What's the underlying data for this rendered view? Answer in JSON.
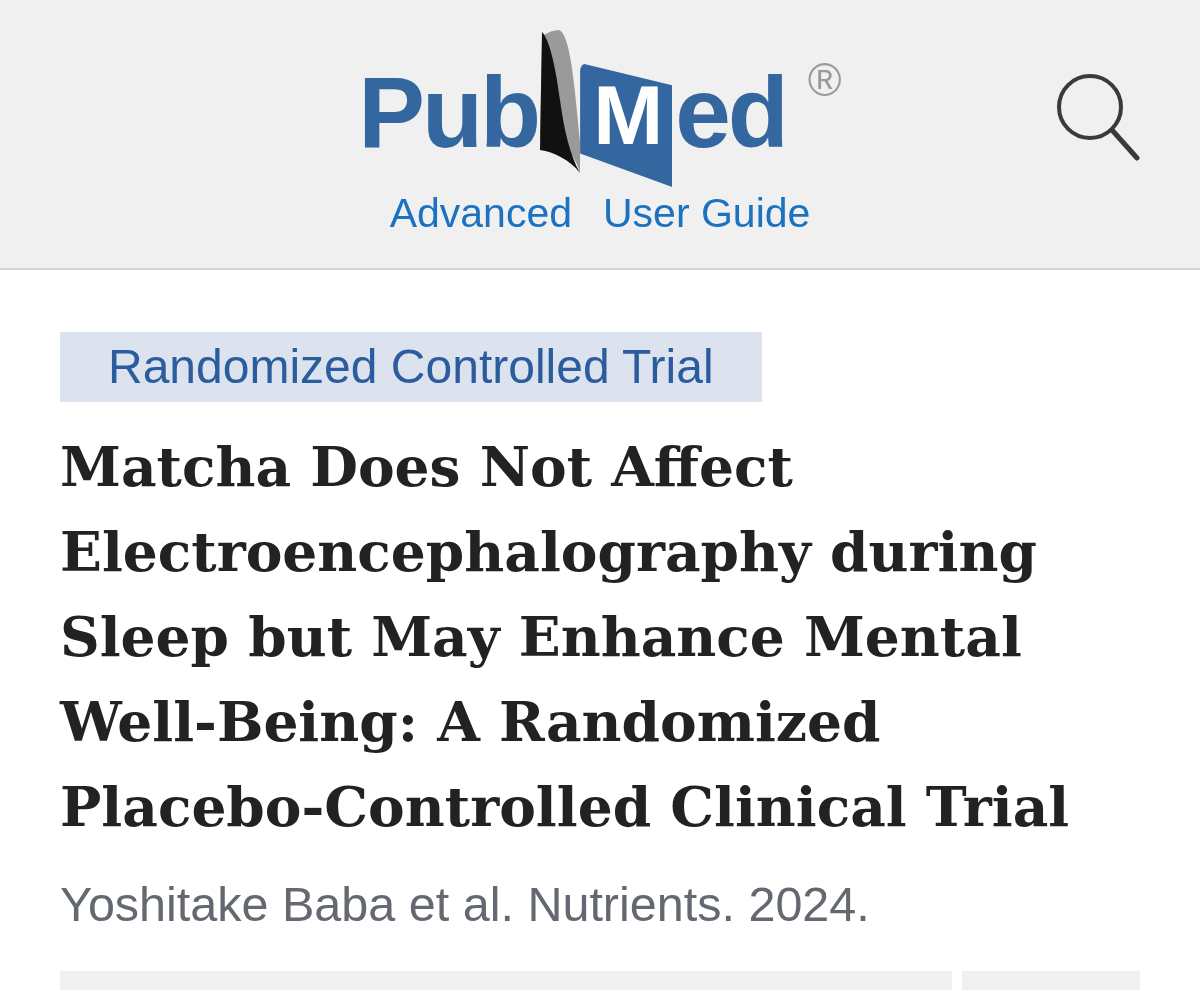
{
  "header": {
    "logo": {
      "prefix": "Pub",
      "page_letter": "M",
      "suffix": "ed",
      "mark": "®"
    },
    "links": [
      "Advanced",
      "User Guide"
    ]
  },
  "article": {
    "publication_type": "Randomized Controlled Trial",
    "title": "Matcha Does Not Affect Electroencephalography during Sleep but May Enhance Mental Well-Being: A Randomized Placebo-Controlled Clinical Trial",
    "citation": "Yoshitake Baba et al. Nutrients. 2024."
  }
}
